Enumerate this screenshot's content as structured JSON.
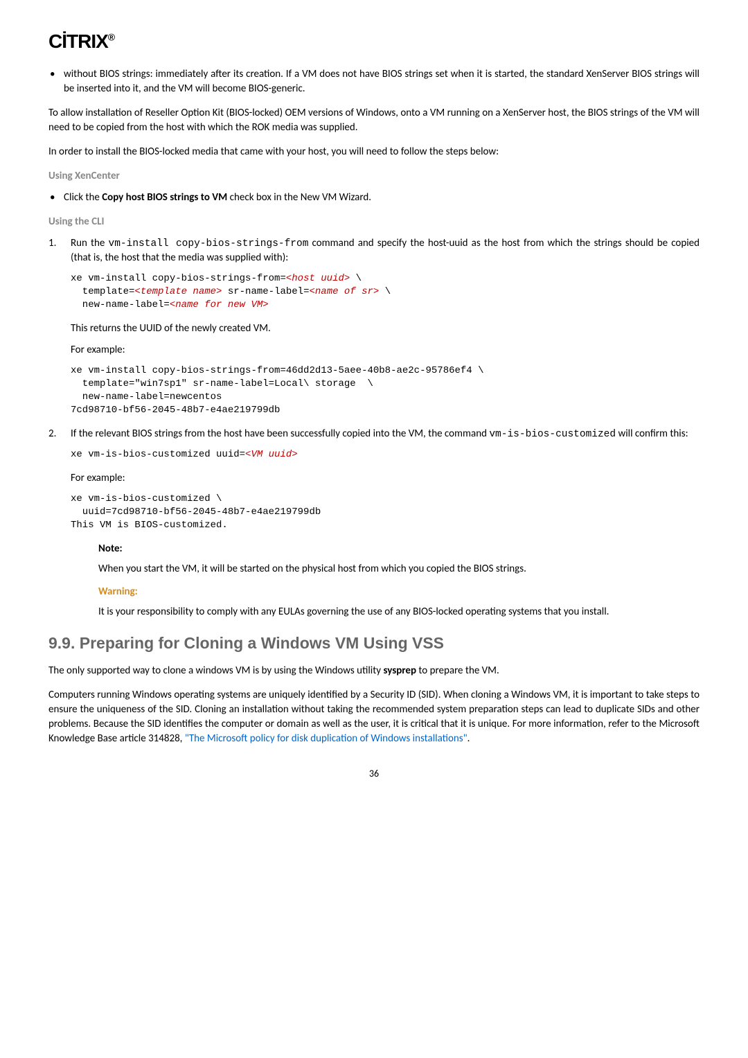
{
  "logo": "CİTRIX",
  "bullet1": "without BIOS strings: immediately after its creation. If a VM does not have BIOS strings set when it is started, the standard XenServer BIOS strings will be inserted into it, and the VM will become BIOS-generic.",
  "para1": "To allow installation of Reseller Option Kit (BIOS-locked) OEM versions of Windows, onto a VM running on a XenServer host, the BIOS strings of the VM will need to be copied from the host with which the ROK media was supplied.",
  "para2": "In order to install the BIOS-locked media that came with your host, you will need to follow the steps below:",
  "sub1": "Using XenCenter",
  "bullet2_pre": "Click the ",
  "bullet2_bold": "Copy host BIOS strings to VM",
  "bullet2_post": " check box in the New VM Wizard.",
  "sub2": "Using the CLI",
  "step1_pre": "Run the ",
  "step1_cmd": "vm-install copy-bios-strings-from",
  "step1_post": " command and specify the host-uuid as the host from which the strings should be copied (that is, the host that the media was supplied with):",
  "code1_a": "xe vm-install copy-bios-strings-from=",
  "code1_ph1": "<host uuid>",
  "code1_b": " \\\n  template=",
  "code1_ph2": "<template name>",
  "code1_c": " sr-name-label=",
  "code1_ph3": "<name of sr>",
  "code1_d": " \\\n  new-name-label=",
  "code1_ph4": "<name for new VM>",
  "step1_ret": "This returns the UUID of the newly created VM.",
  "step1_eg": "For example:",
  "code2": "xe vm-install copy-bios-strings-from=46dd2d13-5aee-40b8-ae2c-95786ef4 \\\n  template=\"win7sp1\" sr-name-label=Local\\ storage  \\\n  new-name-label=newcentos\n7cd98710-bf56-2045-48b7-e4ae219799db",
  "step2_pre": "If the relevant BIOS strings from the host have been successfully copied into the VM, the command ",
  "step2_cmd": "vm-is-bios-customized",
  "step2_post": " will confirm this:",
  "code3_a": "xe vm-is-bios-customized uuid=",
  "code3_ph": "<VM uuid>",
  "step2_eg": "For example:",
  "code4": "xe vm-is-bios-customized \\\n  uuid=7cd98710-bf56-2045-48b7-e4ae219799db\nThis VM is BIOS-customized.",
  "note_label": "Note:",
  "note_body": "When you start the VM, it will be started on the physical host from which you copied the BIOS strings.",
  "warn_label": "Warning:",
  "warn_body": "It is your responsibility to comply with any EULAs governing the use of any BIOS-locked operating systems that you install.",
  "h2": "9.9. Preparing for Cloning a Windows VM Using VSS",
  "clonepara1_pre": "The only supported way to clone a windows VM is by using the Windows utility ",
  "clonepara1_bold": "sysprep",
  "clonepara1_post": " to prepare the VM.",
  "clonepara2_pre": "Computers running Windows operating systems are uniquely identified by a Security ID (SID). When cloning a Windows VM, it is important to take steps to ensure the uniqueness of the SID. Cloning an installation without taking the recommended system preparation steps can lead to duplicate SIDs and other problems. Because the SID identifies the computer or domain as well as the user, it is critical that it is unique. For more information, refer to the Microsoft Knowledge Base article 314828, ",
  "clonepara2_link": "\"The Microsoft policy for disk duplication of Windows installations\"",
  "clonepara2_post": ".",
  "pagenum": "36"
}
